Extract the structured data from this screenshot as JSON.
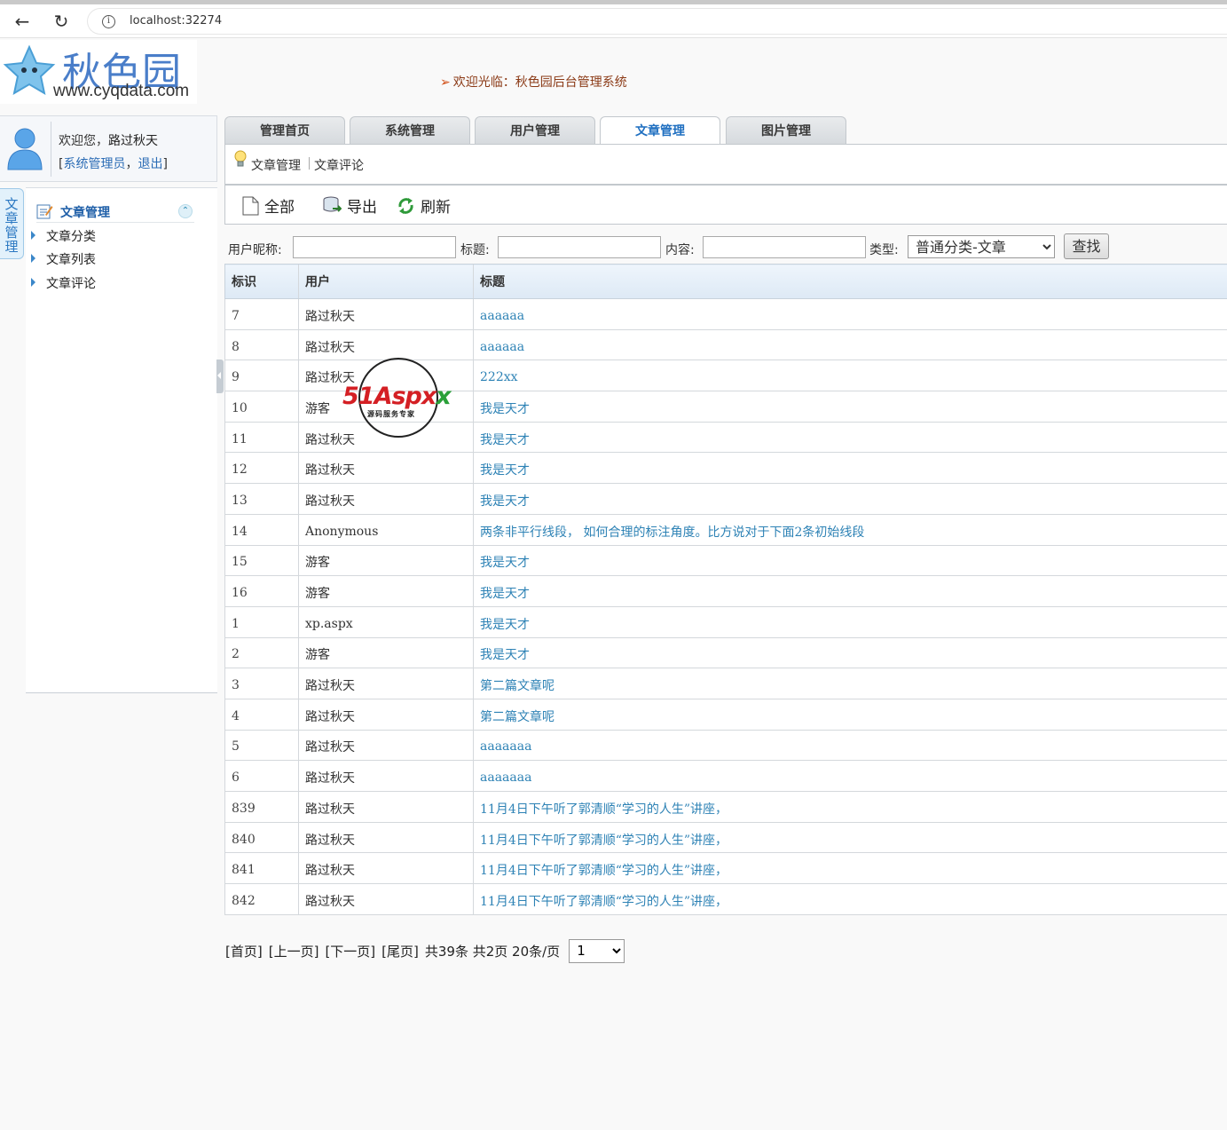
{
  "browser": {
    "url": "localhost:32274"
  },
  "header": {
    "brand": "秋色园",
    "site": "www.cyqdata.com",
    "welcome": "欢迎光临：秋色园后台管理系统"
  },
  "user": {
    "greeting": "欢迎您，",
    "name": "路过秋天",
    "role": "系统管理员",
    "logout": "退出"
  },
  "sidebar": {
    "tab_label": "文章管理",
    "heading": "文章管理",
    "items": [
      {
        "label": "文章分类"
      },
      {
        "label": "文章列表"
      },
      {
        "label": "文章评论"
      }
    ]
  },
  "tabs": [
    {
      "label": "管理首页"
    },
    {
      "label": "系统管理"
    },
    {
      "label": "用户管理"
    },
    {
      "label": "文章管理"
    },
    {
      "label": "图片管理"
    }
  ],
  "subnav": {
    "items": [
      {
        "label": "文章管理"
      },
      {
        "label": "文章评论"
      }
    ]
  },
  "toolbar": {
    "all": "全部",
    "export": "导出",
    "refresh": "刷新"
  },
  "filter": {
    "nickname_label": "用户昵称:",
    "title_label": "标题:",
    "content_label": "内容:",
    "type_label": "类型:",
    "type_value": "普通分类-文章",
    "find": "查找"
  },
  "table": {
    "headers": [
      "标识",
      "用户",
      "标题"
    ],
    "rows": [
      {
        "id": "7",
        "user": "路过秋天",
        "title": "aaaaaa"
      },
      {
        "id": "8",
        "user": "路过秋天",
        "title": "aaaaaa"
      },
      {
        "id": "9",
        "user": "路过秋天",
        "title": "222xx"
      },
      {
        "id": "10",
        "user": "游客",
        "title": "我是天才"
      },
      {
        "id": "11",
        "user": "路过秋天",
        "title": "我是天才"
      },
      {
        "id": "12",
        "user": "路过秋天",
        "title": "我是天才"
      },
      {
        "id": "13",
        "user": "路过秋天",
        "title": "我是天才"
      },
      {
        "id": "14",
        "user": "Anonymous",
        "title": "两条非平行线段， 如何合理的标注角度。比方说对于下面2条初始线段"
      },
      {
        "id": "15",
        "user": "游客",
        "title": "我是天才"
      },
      {
        "id": "16",
        "user": "游客",
        "title": "我是天才"
      },
      {
        "id": "1",
        "user": "xp.aspx",
        "title": "我是天才"
      },
      {
        "id": "2",
        "user": "游客",
        "title": "我是天才"
      },
      {
        "id": "3",
        "user": "路过秋天",
        "title": "第二篇文章呢"
      },
      {
        "id": "4",
        "user": "路过秋天",
        "title": "第二篇文章呢"
      },
      {
        "id": "5",
        "user": "路过秋天",
        "title": "aaaaaaa"
      },
      {
        "id": "6",
        "user": "路过秋天",
        "title": "aaaaaaa"
      },
      {
        "id": "839",
        "user": "路过秋天",
        "title": "11月4日下午听了郭清顺“学习的人生”讲座，"
      },
      {
        "id": "840",
        "user": "路过秋天",
        "title": "11月4日下午听了郭清顺“学习的人生”讲座，"
      },
      {
        "id": "841",
        "user": "路过秋天",
        "title": "11月4日下午听了郭清顺“学习的人生”讲座，"
      },
      {
        "id": "842",
        "user": "路过秋天",
        "title": "11月4日下午听了郭清顺“学习的人生”讲座，"
      }
    ]
  },
  "pager": {
    "first": "[首页]",
    "prev": "[上一页]",
    "next": "[下一页]",
    "last": "[尾页]",
    "summary": "共39条 共2页 20条/页",
    "page_value": "1"
  },
  "watermark": {
    "text_a": "51",
    "text_b": "Aspx",
    "text_c": "x",
    "sub": "源码服务专家"
  }
}
